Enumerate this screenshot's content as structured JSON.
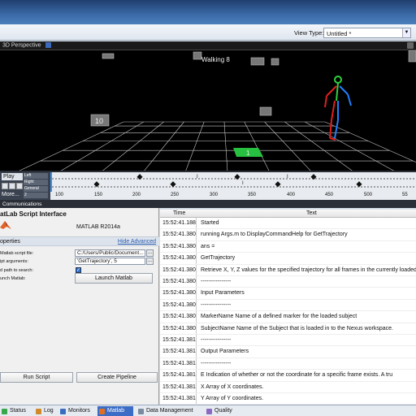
{
  "toolbar": {
    "view_type_label": "View Type:",
    "view_type_value": "Untitled *"
  },
  "viewport": {
    "title": "3D Perspective",
    "subject_label": "Walking 8",
    "floor_marker_label": "1",
    "camera_label": "10",
    "colors": {
      "grid": "#c8c8c8",
      "floor_marker": "#28c040",
      "skeleton_left": "#e02020",
      "skeleton_right": "#2080ff",
      "skeleton_mid": "#30d040"
    }
  },
  "timeline": {
    "play_label": "Play",
    "segments": [
      "Left",
      "Right",
      "General",
      "2"
    ],
    "more_label": "More...",
    "ticks": [
      "100",
      "150",
      "200",
      "250",
      "300",
      "350",
      "400",
      "450",
      "500",
      "55"
    ]
  },
  "comm_header": "Communications",
  "left_panel": {
    "title": "atLab Script Interface",
    "matlab_version": "MATLAB R2014a",
    "properties_label": "operties",
    "advanced_link": "Hide Advanced",
    "script_file_label": "Matlab script file:",
    "script_file_value": "C:/Users/Public/Document...",
    "script_args_label": "ipt arguments:",
    "script_args_value": "'GetTrajectory', 5",
    "add_path_label": "d path to search:",
    "launch_label": "unch Matlab:",
    "launch_button": "Launch Matlab",
    "run_script_button": "Run Script",
    "create_pipeline_button": "Create Pipeline"
  },
  "log": {
    "col_time": "Time",
    "col_text": "Text",
    "rows": [
      {
        "time": "15:52:41.188",
        "text": "Started"
      },
      {
        "time": "15:52:41.380",
        "text": "running Args.m to DisplayCommandHelp for GetTrajectory"
      },
      {
        "time": "15:52:41.380",
        "text": "ans ="
      },
      {
        "time": "15:52:41.380",
        "text": "GetTrajectory"
      },
      {
        "time": "15:52:41.380",
        "text": "Retrieve X, Y, Z values for the specified trajectory for all frames in the currently loaded"
      },
      {
        "time": "15:52:41.380",
        "text": "----------------"
      },
      {
        "time": "15:52:41.380",
        "text": "Input Parameters"
      },
      {
        "time": "15:52:41.380",
        "text": "----------------"
      },
      {
        "time": "15:52:41.380",
        "text": "MarkerName    Name of a defined marker for the loaded subject"
      },
      {
        "time": "15:52:41.380",
        "text": "SubjectName   Name of the Subject that is loaded in to the Nexus workspace."
      },
      {
        "time": "15:52:41.381",
        "text": "----------------"
      },
      {
        "time": "15:52:41.381",
        "text": "Output Parameters"
      },
      {
        "time": "15:52:41.381",
        "text": "----------------"
      },
      {
        "time": "15:52:41.381",
        "text": "E          Indication of whether or not the coordinate for a specific frame exists. A tru"
      },
      {
        "time": "15:52:41.381",
        "text": "X          Array of X coordinates."
      },
      {
        "time": "15:52:41.381",
        "text": "Y          Array of Y coordinates."
      }
    ]
  },
  "status_tabs": [
    {
      "label": "Status",
      "icon": "status-icon",
      "color": "#3aa84a"
    },
    {
      "label": "Log",
      "icon": "log-icon",
      "color": "#d08a2a"
    },
    {
      "label": "Monitors",
      "icon": "monitors-icon",
      "color": "#3a6fc0"
    },
    {
      "label": "Matlab",
      "icon": "matlab-icon",
      "color": "#e07020"
    },
    {
      "label": "Data Management",
      "icon": "data-management-icon",
      "color": "#7a8aa0"
    },
    {
      "label": "Quality",
      "icon": "quality-icon",
      "color": "#8a6ac0"
    }
  ],
  "active_tab": "Matlab"
}
